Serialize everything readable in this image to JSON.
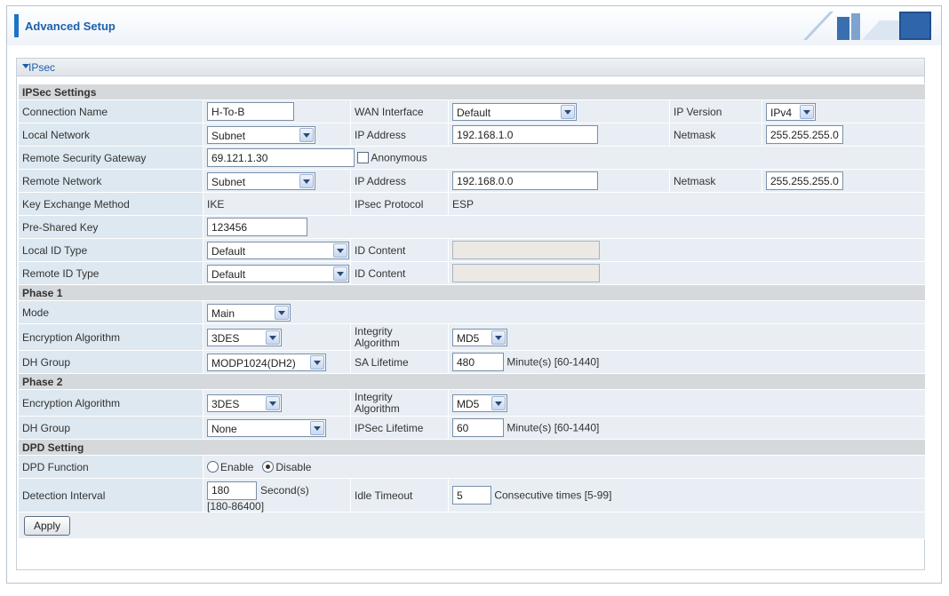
{
  "header": {
    "title": "Advanced Setup"
  },
  "panel": {
    "title": "IPsec"
  },
  "ipsec_settings": {
    "section": "IPSec Settings",
    "connection_name": {
      "label": "Connection Name",
      "value": "H-To-B"
    },
    "wan_interface": {
      "label": "WAN Interface",
      "value": "Default"
    },
    "ip_version": {
      "label": "IP Version",
      "value": "IPv4"
    },
    "local_network": {
      "label": "Local Network",
      "value": "Subnet"
    },
    "local_ip": {
      "label": "IP Address",
      "value": "192.168.1.0"
    },
    "local_netmask": {
      "label": "Netmask",
      "value": "255.255.255.0"
    },
    "remote_gateway": {
      "label": "Remote Security Gateway",
      "value": "69.121.1.30",
      "anonymous_label": "Anonymous",
      "anonymous_checked": false
    },
    "remote_network": {
      "label": "Remote Network",
      "value": "Subnet"
    },
    "remote_ip": {
      "label": "IP Address",
      "value": "192.168.0.0"
    },
    "remote_netmask": {
      "label": "Netmask",
      "value": "255.255.255.0"
    },
    "key_exchange": {
      "label": "Key Exchange Method",
      "value": "IKE"
    },
    "ipsec_protocol": {
      "label": "IPsec Protocol",
      "value": "ESP"
    },
    "psk": {
      "label": "Pre-Shared Key",
      "value": "123456"
    },
    "local_id_type": {
      "label": "Local ID Type",
      "value": "Default"
    },
    "local_id_content": {
      "label": "ID Content",
      "value": ""
    },
    "remote_id_type": {
      "label": "Remote ID Type",
      "value": "Default"
    },
    "remote_id_content": {
      "label": "ID Content",
      "value": ""
    }
  },
  "phase1": {
    "section": "Phase 1",
    "mode": {
      "label": "Mode",
      "value": "Main"
    },
    "encryption": {
      "label": "Encryption Algorithm",
      "value": "3DES"
    },
    "integrity": {
      "label_line1": "Integrity",
      "label_line2": "Algorithm",
      "value": "MD5"
    },
    "dh_group": {
      "label": "DH Group",
      "value": "MODP1024(DH2)"
    },
    "sa_lifetime": {
      "label": "SA Lifetime",
      "value": "480",
      "unit": "Minute(s) [60-1440]"
    }
  },
  "phase2": {
    "section": "Phase 2",
    "encryption": {
      "label": "Encryption Algorithm",
      "value": "3DES"
    },
    "integrity": {
      "label_line1": "Integrity",
      "label_line2": "Algorithm",
      "value": "MD5"
    },
    "dh_group": {
      "label": "DH Group",
      "value": "None"
    },
    "ipsec_lifetime": {
      "label": "IPSec Lifetime",
      "value": "60",
      "unit": "Minute(s) [60-1440]"
    }
  },
  "dpd": {
    "section": "DPD Setting",
    "function": {
      "label": "DPD Function",
      "enable_label": "Enable",
      "disable_label": "Disable",
      "selected": "Disable"
    },
    "interval": {
      "label": "Detection Interval",
      "value": "180",
      "unit_line1": "Second(s)",
      "unit_line2": "[180-86400]"
    },
    "idle_timeout": {
      "label": "Idle Timeout",
      "value": "5",
      "unit": "Consecutive times [5-99]"
    }
  },
  "apply_label": "Apply",
  "colors": {
    "accent": "#1c73c7",
    "title": "#1d5fa8",
    "label_bg": "#dde8f0",
    "value_bg": "#e8eef4",
    "section_bg": "#d6d9dc"
  }
}
